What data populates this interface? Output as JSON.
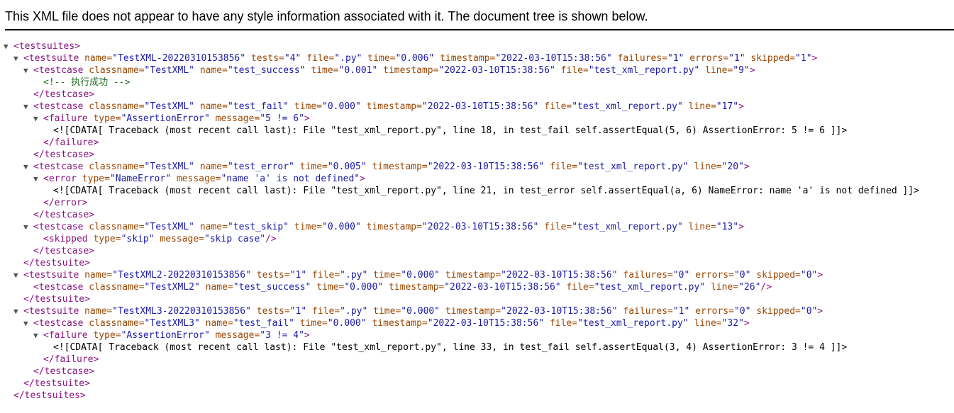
{
  "header": {
    "message": "This XML file does not appear to have any style information associated with it. The document tree is shown below."
  },
  "lines": [
    {
      "depth": 0,
      "toggle": true,
      "parts": [
        {
          "c": "tg",
          "t": "<testsuites>"
        }
      ]
    },
    {
      "depth": 1,
      "toggle": true,
      "parts": [
        {
          "c": "tg",
          "t": "<testsuite"
        },
        {
          "c": "an",
          "t": " name="
        },
        {
          "c": "av",
          "t": "\"TestXML-20220310153856\""
        },
        {
          "c": "an",
          "t": " tests="
        },
        {
          "c": "av",
          "t": "\"4\""
        },
        {
          "c": "an",
          "t": " file="
        },
        {
          "c": "av",
          "t": "\".py\""
        },
        {
          "c": "an",
          "t": " time="
        },
        {
          "c": "av",
          "t": "\"0.006\""
        },
        {
          "c": "an",
          "t": " timestamp="
        },
        {
          "c": "av",
          "t": "\"2022-03-10T15:38:56\""
        },
        {
          "c": "an",
          "t": " failures="
        },
        {
          "c": "av",
          "t": "\"1\""
        },
        {
          "c": "an",
          "t": " errors="
        },
        {
          "c": "av",
          "t": "\"1\""
        },
        {
          "c": "an",
          "t": " skipped="
        },
        {
          "c": "av",
          "t": "\"1\""
        },
        {
          "c": "tg",
          "t": ">"
        }
      ]
    },
    {
      "depth": 2,
      "toggle": true,
      "parts": [
        {
          "c": "tg",
          "t": "<testcase"
        },
        {
          "c": "an",
          "t": " classname="
        },
        {
          "c": "av",
          "t": "\"TestXML\""
        },
        {
          "c": "an",
          "t": " name="
        },
        {
          "c": "av",
          "t": "\"test_success\""
        },
        {
          "c": "an",
          "t": " time="
        },
        {
          "c": "av",
          "t": "\"0.001\""
        },
        {
          "c": "an",
          "t": " timestamp="
        },
        {
          "c": "av",
          "t": "\"2022-03-10T15:38:56\""
        },
        {
          "c": "an",
          "t": " file="
        },
        {
          "c": "av",
          "t": "\"test_xml_report.py\""
        },
        {
          "c": "an",
          "t": " line="
        },
        {
          "c": "av",
          "t": "\"9\""
        },
        {
          "c": "tg",
          "t": ">"
        }
      ]
    },
    {
      "depth": 3,
      "toggle": false,
      "parts": [
        {
          "c": "cm",
          "t": "<!-- 执行成功 -->"
        }
      ]
    },
    {
      "depth": 2,
      "toggle": false,
      "parts": [
        {
          "c": "tg",
          "t": "</testcase>"
        }
      ]
    },
    {
      "depth": 2,
      "toggle": true,
      "parts": [
        {
          "c": "tg",
          "t": "<testcase"
        },
        {
          "c": "an",
          "t": " classname="
        },
        {
          "c": "av",
          "t": "\"TestXML\""
        },
        {
          "c": "an",
          "t": " name="
        },
        {
          "c": "av",
          "t": "\"test_fail\""
        },
        {
          "c": "an",
          "t": " time="
        },
        {
          "c": "av",
          "t": "\"0.000\""
        },
        {
          "c": "an",
          "t": " timestamp="
        },
        {
          "c": "av",
          "t": "\"2022-03-10T15:38:56\""
        },
        {
          "c": "an",
          "t": " file="
        },
        {
          "c": "av",
          "t": "\"test_xml_report.py\""
        },
        {
          "c": "an",
          "t": " line="
        },
        {
          "c": "av",
          "t": "\"17\""
        },
        {
          "c": "tg",
          "t": ">"
        }
      ]
    },
    {
      "depth": 3,
      "toggle": true,
      "parts": [
        {
          "c": "tg",
          "t": "<failure"
        },
        {
          "c": "an",
          "t": " type="
        },
        {
          "c": "av",
          "t": "\"AssertionError\""
        },
        {
          "c": "an",
          "t": " message="
        },
        {
          "c": "av",
          "t": "\"5 != 6\""
        },
        {
          "c": "tg",
          "t": ">"
        }
      ]
    },
    {
      "depth": 4,
      "toggle": false,
      "parts": [
        {
          "c": "tx",
          "t": "<![CDATA[ Traceback (most recent call last): File \"test_xml_report.py\", line 18, in test_fail self.assertEqual(5, 6) AssertionError: 5 != 6 ]]>"
        }
      ]
    },
    {
      "depth": 3,
      "toggle": false,
      "parts": [
        {
          "c": "tg",
          "t": "</failure>"
        }
      ]
    },
    {
      "depth": 2,
      "toggle": false,
      "parts": [
        {
          "c": "tg",
          "t": "</testcase>"
        }
      ]
    },
    {
      "depth": 2,
      "toggle": true,
      "parts": [
        {
          "c": "tg",
          "t": "<testcase"
        },
        {
          "c": "an",
          "t": " classname="
        },
        {
          "c": "av",
          "t": "\"TestXML\""
        },
        {
          "c": "an",
          "t": " name="
        },
        {
          "c": "av",
          "t": "\"test_error\""
        },
        {
          "c": "an",
          "t": " time="
        },
        {
          "c": "av",
          "t": "\"0.005\""
        },
        {
          "c": "an",
          "t": " timestamp="
        },
        {
          "c": "av",
          "t": "\"2022-03-10T15:38:56\""
        },
        {
          "c": "an",
          "t": " file="
        },
        {
          "c": "av",
          "t": "\"test_xml_report.py\""
        },
        {
          "c": "an",
          "t": " line="
        },
        {
          "c": "av",
          "t": "\"20\""
        },
        {
          "c": "tg",
          "t": ">"
        }
      ]
    },
    {
      "depth": 3,
      "toggle": true,
      "parts": [
        {
          "c": "tg",
          "t": "<error"
        },
        {
          "c": "an",
          "t": " type="
        },
        {
          "c": "av",
          "t": "\"NameError\""
        },
        {
          "c": "an",
          "t": " message="
        },
        {
          "c": "av",
          "t": "\"name 'a' is not defined\""
        },
        {
          "c": "tg",
          "t": ">"
        }
      ]
    },
    {
      "depth": 4,
      "toggle": false,
      "parts": [
        {
          "c": "tx",
          "t": "<![CDATA[ Traceback (most recent call last): File \"test_xml_report.py\", line 21, in test_error self.assertEqual(a, 6) NameError: name 'a' is not defined ]]>"
        }
      ]
    },
    {
      "depth": 3,
      "toggle": false,
      "parts": [
        {
          "c": "tg",
          "t": "</error>"
        }
      ]
    },
    {
      "depth": 2,
      "toggle": false,
      "parts": [
        {
          "c": "tg",
          "t": "</testcase>"
        }
      ]
    },
    {
      "depth": 2,
      "toggle": true,
      "parts": [
        {
          "c": "tg",
          "t": "<testcase"
        },
        {
          "c": "an",
          "t": " classname="
        },
        {
          "c": "av",
          "t": "\"TestXML\""
        },
        {
          "c": "an",
          "t": " name="
        },
        {
          "c": "av",
          "t": "\"test_skip\""
        },
        {
          "c": "an",
          "t": " time="
        },
        {
          "c": "av",
          "t": "\"0.000\""
        },
        {
          "c": "an",
          "t": " timestamp="
        },
        {
          "c": "av",
          "t": "\"2022-03-10T15:38:56\""
        },
        {
          "c": "an",
          "t": " file="
        },
        {
          "c": "av",
          "t": "\"test_xml_report.py\""
        },
        {
          "c": "an",
          "t": " line="
        },
        {
          "c": "av",
          "t": "\"13\""
        },
        {
          "c": "tg",
          "t": ">"
        }
      ]
    },
    {
      "depth": 3,
      "toggle": false,
      "parts": [
        {
          "c": "tg",
          "t": "<skipped"
        },
        {
          "c": "an",
          "t": " type="
        },
        {
          "c": "av",
          "t": "\"skip\""
        },
        {
          "c": "an",
          "t": " message="
        },
        {
          "c": "av",
          "t": "\"skip case\""
        },
        {
          "c": "tg",
          "t": "/>"
        }
      ]
    },
    {
      "depth": 2,
      "toggle": false,
      "parts": [
        {
          "c": "tg",
          "t": "</testcase>"
        }
      ]
    },
    {
      "depth": 1,
      "toggle": false,
      "parts": [
        {
          "c": "tg",
          "t": "</testsuite>"
        }
      ]
    },
    {
      "depth": 1,
      "toggle": true,
      "parts": [
        {
          "c": "tg",
          "t": "<testsuite"
        },
        {
          "c": "an",
          "t": " name="
        },
        {
          "c": "av",
          "t": "\"TestXML2-20220310153856\""
        },
        {
          "c": "an",
          "t": " tests="
        },
        {
          "c": "av",
          "t": "\"1\""
        },
        {
          "c": "an",
          "t": " file="
        },
        {
          "c": "av",
          "t": "\".py\""
        },
        {
          "c": "an",
          "t": " time="
        },
        {
          "c": "av",
          "t": "\"0.000\""
        },
        {
          "c": "an",
          "t": " timestamp="
        },
        {
          "c": "av",
          "t": "\"2022-03-10T15:38:56\""
        },
        {
          "c": "an",
          "t": " failures="
        },
        {
          "c": "av",
          "t": "\"0\""
        },
        {
          "c": "an",
          "t": " errors="
        },
        {
          "c": "av",
          "t": "\"0\""
        },
        {
          "c": "an",
          "t": " skipped="
        },
        {
          "c": "av",
          "t": "\"0\""
        },
        {
          "c": "tg",
          "t": ">"
        }
      ]
    },
    {
      "depth": 2,
      "toggle": false,
      "parts": [
        {
          "c": "tg",
          "t": "<testcase"
        },
        {
          "c": "an",
          "t": " classname="
        },
        {
          "c": "av",
          "t": "\"TestXML2\""
        },
        {
          "c": "an",
          "t": " name="
        },
        {
          "c": "av",
          "t": "\"test_success\""
        },
        {
          "c": "an",
          "t": " time="
        },
        {
          "c": "av",
          "t": "\"0.000\""
        },
        {
          "c": "an",
          "t": " timestamp="
        },
        {
          "c": "av",
          "t": "\"2022-03-10T15:38:56\""
        },
        {
          "c": "an",
          "t": " file="
        },
        {
          "c": "av",
          "t": "\"test_xml_report.py\""
        },
        {
          "c": "an",
          "t": " line="
        },
        {
          "c": "av",
          "t": "\"26\""
        },
        {
          "c": "tg",
          "t": "/>"
        }
      ]
    },
    {
      "depth": 1,
      "toggle": false,
      "parts": [
        {
          "c": "tg",
          "t": "</testsuite>"
        }
      ]
    },
    {
      "depth": 1,
      "toggle": true,
      "parts": [
        {
          "c": "tg",
          "t": "<testsuite"
        },
        {
          "c": "an",
          "t": " name="
        },
        {
          "c": "av",
          "t": "\"TestXML3-20220310153856\""
        },
        {
          "c": "an",
          "t": " tests="
        },
        {
          "c": "av",
          "t": "\"1\""
        },
        {
          "c": "an",
          "t": " file="
        },
        {
          "c": "av",
          "t": "\".py\""
        },
        {
          "c": "an",
          "t": " time="
        },
        {
          "c": "av",
          "t": "\"0.000\""
        },
        {
          "c": "an",
          "t": " timestamp="
        },
        {
          "c": "av",
          "t": "\"2022-03-10T15:38:56\""
        },
        {
          "c": "an",
          "t": " failures="
        },
        {
          "c": "av",
          "t": "\"1\""
        },
        {
          "c": "an",
          "t": " errors="
        },
        {
          "c": "av",
          "t": "\"0\""
        },
        {
          "c": "an",
          "t": " skipped="
        },
        {
          "c": "av",
          "t": "\"0\""
        },
        {
          "c": "tg",
          "t": ">"
        }
      ]
    },
    {
      "depth": 2,
      "toggle": true,
      "parts": [
        {
          "c": "tg",
          "t": "<testcase"
        },
        {
          "c": "an",
          "t": " classname="
        },
        {
          "c": "av",
          "t": "\"TestXML3\""
        },
        {
          "c": "an",
          "t": " name="
        },
        {
          "c": "av",
          "t": "\"test_fail\""
        },
        {
          "c": "an",
          "t": " time="
        },
        {
          "c": "av",
          "t": "\"0.000\""
        },
        {
          "c": "an",
          "t": " timestamp="
        },
        {
          "c": "av",
          "t": "\"2022-03-10T15:38:56\""
        },
        {
          "c": "an",
          "t": " file="
        },
        {
          "c": "av",
          "t": "\"test_xml_report.py\""
        },
        {
          "c": "an",
          "t": " line="
        },
        {
          "c": "av",
          "t": "\"32\""
        },
        {
          "c": "tg",
          "t": ">"
        }
      ]
    },
    {
      "depth": 3,
      "toggle": true,
      "parts": [
        {
          "c": "tg",
          "t": "<failure"
        },
        {
          "c": "an",
          "t": " type="
        },
        {
          "c": "av",
          "t": "\"AssertionError\""
        },
        {
          "c": "an",
          "t": " message="
        },
        {
          "c": "av",
          "t": "\"3 != 4\""
        },
        {
          "c": "tg",
          "t": ">"
        }
      ]
    },
    {
      "depth": 4,
      "toggle": false,
      "parts": [
        {
          "c": "tx",
          "t": "<![CDATA[ Traceback (most recent call last): File \"test_xml_report.py\", line 33, in test_fail self.assertEqual(3, 4) AssertionError: 3 != 4 ]]>"
        }
      ]
    },
    {
      "depth": 3,
      "toggle": false,
      "parts": [
        {
          "c": "tg",
          "t": "</failure>"
        }
      ]
    },
    {
      "depth": 2,
      "toggle": false,
      "parts": [
        {
          "c": "tg",
          "t": "</testcase>"
        }
      ]
    },
    {
      "depth": 1,
      "toggle": false,
      "parts": [
        {
          "c": "tg",
          "t": "</testsuite>"
        }
      ]
    },
    {
      "depth": 0,
      "toggle": false,
      "parts": [
        {
          "c": "tg",
          "t": "</testsuites>"
        }
      ]
    }
  ]
}
